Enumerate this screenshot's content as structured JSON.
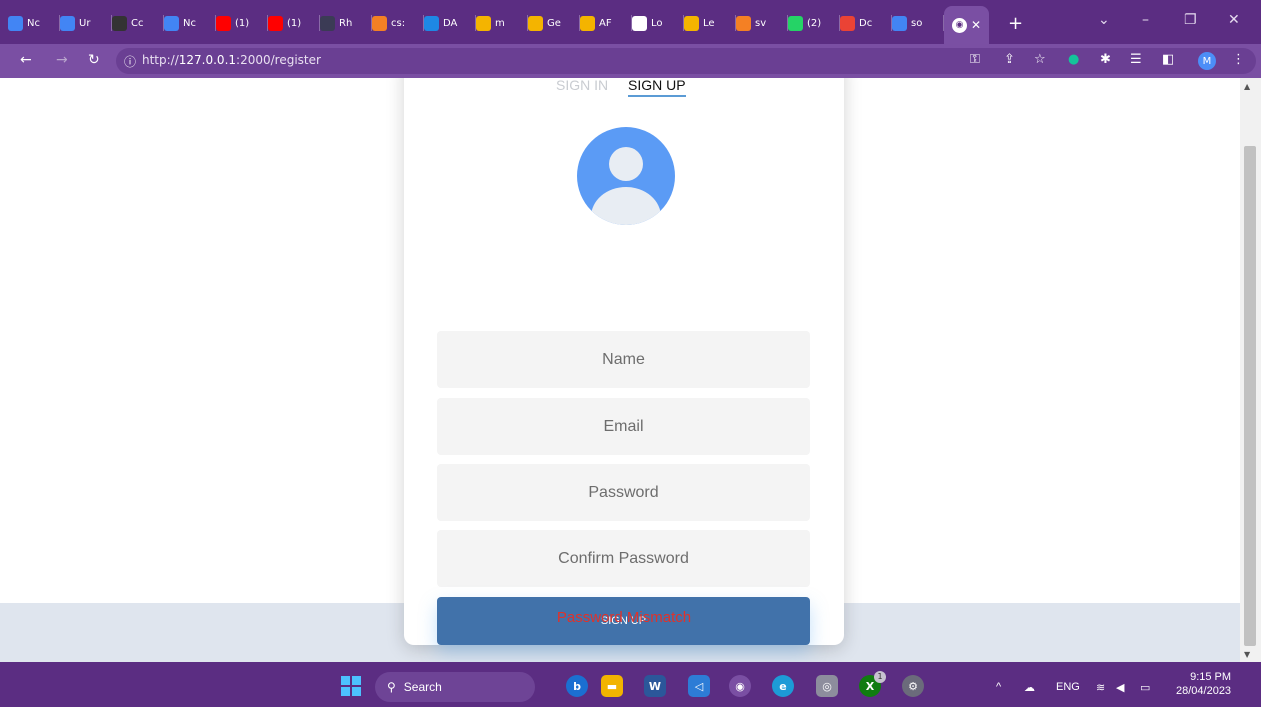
{
  "browser": {
    "tabs": [
      {
        "label": "Nc",
        "icon": "docs-icon",
        "color": "#4285f4"
      },
      {
        "label": "Ur",
        "icon": "docs-icon",
        "color": "#4285f4"
      },
      {
        "label": "Cc",
        "icon": "github-icon",
        "color": "#333333"
      },
      {
        "label": "Nc",
        "icon": "docs-icon",
        "color": "#4285f4"
      },
      {
        "label": "(1)",
        "icon": "youtube-icon",
        "color": "#ff0000"
      },
      {
        "label": "(1)",
        "icon": "youtube-icon",
        "color": "#ff0000"
      },
      {
        "label": "Rh",
        "icon": "app-icon",
        "color": "#3b3b55"
      },
      {
        "label": "cs:",
        "icon": "stackoverflow-icon",
        "color": "#f48024"
      },
      {
        "label": "DA",
        "icon": "s-icon",
        "color": "#1e88e5"
      },
      {
        "label": "m",
        "icon": "bookmark-icon",
        "color": "#f4b400"
      },
      {
        "label": "Ge",
        "icon": "bookmark-icon",
        "color": "#f4b400"
      },
      {
        "label": "AF",
        "icon": "bookmark-icon",
        "color": "#f4b400"
      },
      {
        "label": "Lo",
        "icon": "globe-icon",
        "color": "#ffffff"
      },
      {
        "label": "Le",
        "icon": "bookmark-icon",
        "color": "#f4b400"
      },
      {
        "label": "sv",
        "icon": "stackoverflow-icon",
        "color": "#f48024"
      },
      {
        "label": "(2)",
        "icon": "whatsapp-icon",
        "color": "#25d366"
      },
      {
        "label": "Dc",
        "icon": "gmail-icon",
        "color": "#ea4335"
      },
      {
        "label": "so",
        "icon": "docs-icon",
        "color": "#4285f4"
      }
    ],
    "new_tab_label": "+",
    "url_prefix": "http://",
    "url_host": "127.0.0.1",
    "url_path": ":2000/register",
    "profile_initial": "M"
  },
  "page": {
    "tab_signin": "SIGN IN",
    "tab_signup": "SIGN UP",
    "fields": {
      "name_placeholder": "Name",
      "email_placeholder": "Email",
      "password_placeholder": "Password",
      "confirm_placeholder": "Confirm Password"
    },
    "submit_label": "SIGN UP",
    "error_message": "Password Mismatch"
  },
  "taskbar": {
    "search_label": "Search",
    "language": "ENG",
    "time": "9:15 PM",
    "date": "28/04/2023",
    "xbox_badge": "1"
  }
}
